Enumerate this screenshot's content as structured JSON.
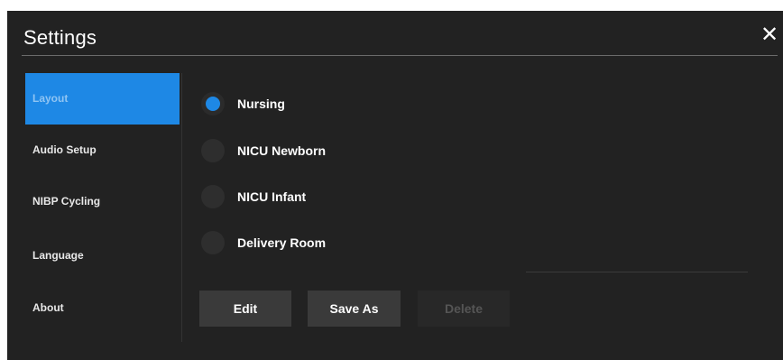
{
  "dialog": {
    "title": "Settings",
    "close_glyph": "✕"
  },
  "sidebar": {
    "items": [
      {
        "label": "Layout",
        "active": true
      },
      {
        "label": "Audio Setup",
        "active": false
      },
      {
        "label": "NIBP Cycling",
        "active": false
      },
      {
        "label": "Language",
        "active": false
      },
      {
        "label": "About",
        "active": false
      }
    ]
  },
  "layouts": {
    "options": [
      {
        "label": "Nursing",
        "selected": true
      },
      {
        "label": "NICU Newborn",
        "selected": false
      },
      {
        "label": "NICU Infant",
        "selected": false
      },
      {
        "label": "Delivery Room",
        "selected": false
      }
    ]
  },
  "actions": {
    "edit_label": "Edit",
    "save_as_label": "Save As",
    "delete_label": "Delete"
  },
  "colors": {
    "accent": "#1e88e5",
    "panel_background": "#222222"
  },
  "icons": {
    "close": "close-icon"
  }
}
